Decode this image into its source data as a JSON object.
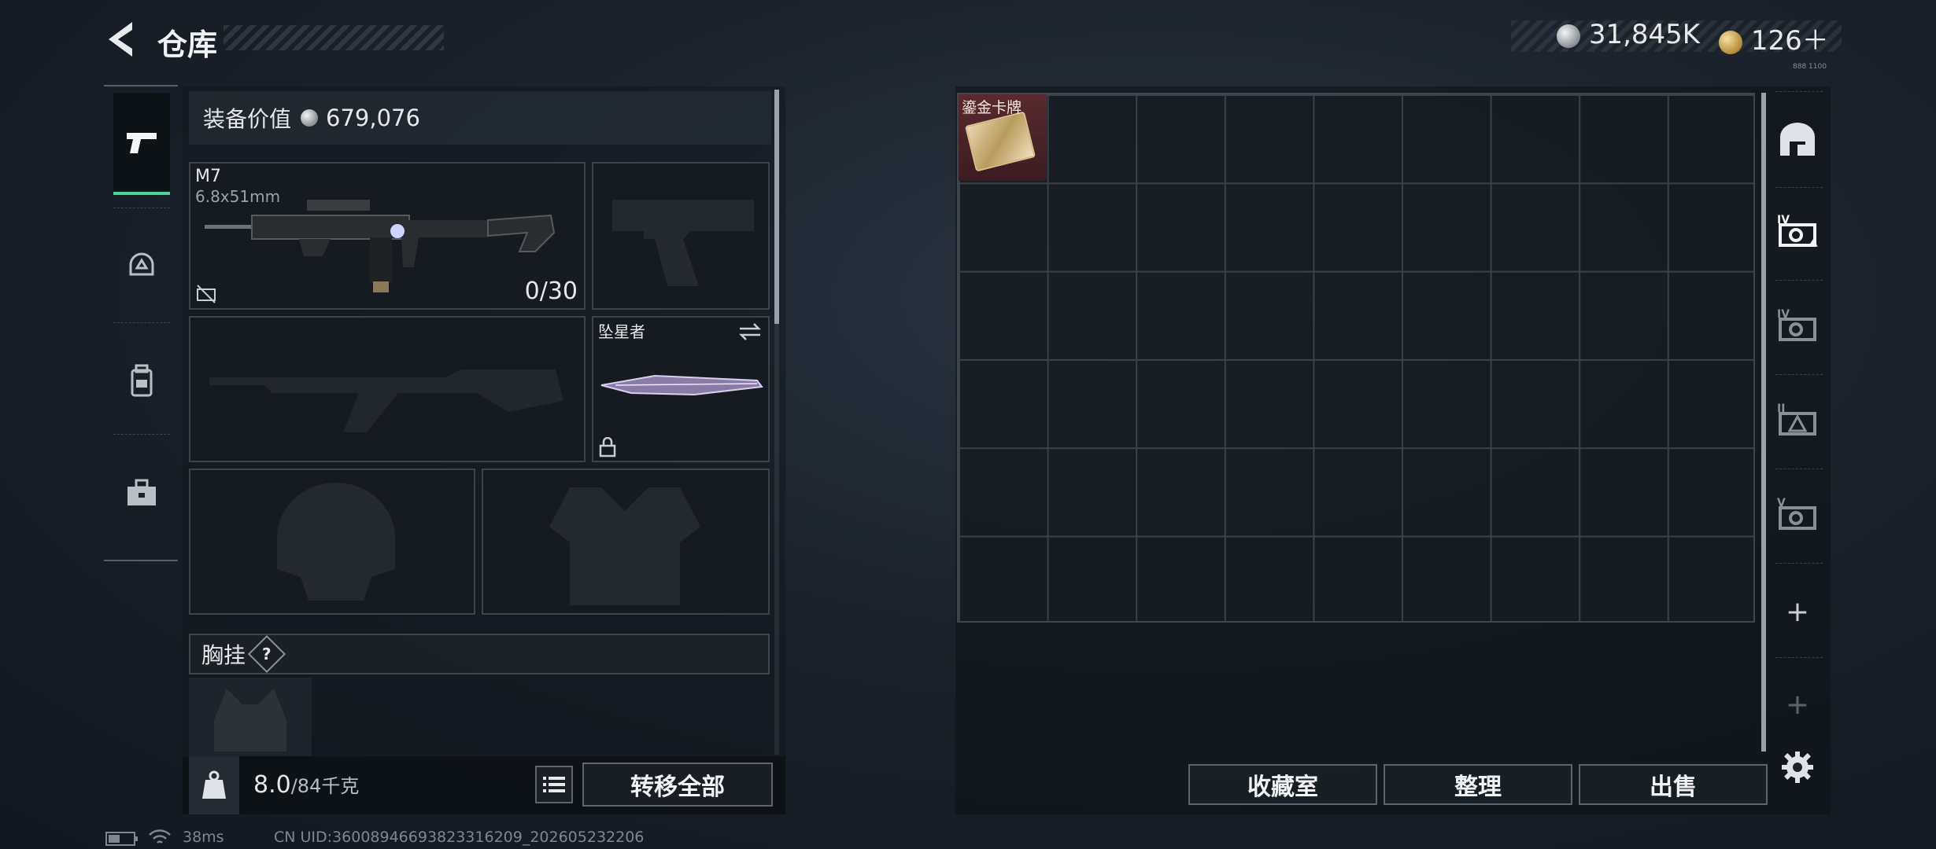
{
  "header": {
    "title": "仓库",
    "back_icon": "back-arrow-icon"
  },
  "currency": {
    "silver": "31,845K",
    "gold": "126＋",
    "tiny_tag": "888 1100"
  },
  "left_nav": {
    "items": [
      {
        "icon": "pistol-icon",
        "active": true
      },
      {
        "icon": "helmet-icon",
        "active": false
      },
      {
        "icon": "backpack-icon",
        "active": false
      },
      {
        "icon": "toolbox-icon",
        "active": false
      }
    ]
  },
  "loadout": {
    "value_label": "装备价值",
    "value_amount": "679,076",
    "primary": {
      "name": "M7",
      "caliber": "6.8x51mm",
      "ammo": "0/30"
    },
    "melee": {
      "name": "坠星者"
    },
    "chest_rig_label": "胸挂",
    "chest_rig_help": "?",
    "weight_value": "8.0",
    "weight_capacity": "/84千克",
    "transfer_all_label": "转移全部"
  },
  "stash": {
    "items": [
      {
        "name": "鎏金卡牌",
        "color": "#5a2a30"
      }
    ],
    "buttons": {
      "collection": "收藏室",
      "organize": "整理",
      "sell": "出售"
    },
    "side_icons": [
      "stash-main-icon",
      "stash-tab-iv-icon",
      "stash-tab-iv-icon",
      "stash-tab-ii-icon",
      "stash-tab-v-icon"
    ],
    "add_label": "+"
  },
  "footer": {
    "ping": "38ms",
    "uid": "CN UID:36008946693823316209_202605232206"
  }
}
